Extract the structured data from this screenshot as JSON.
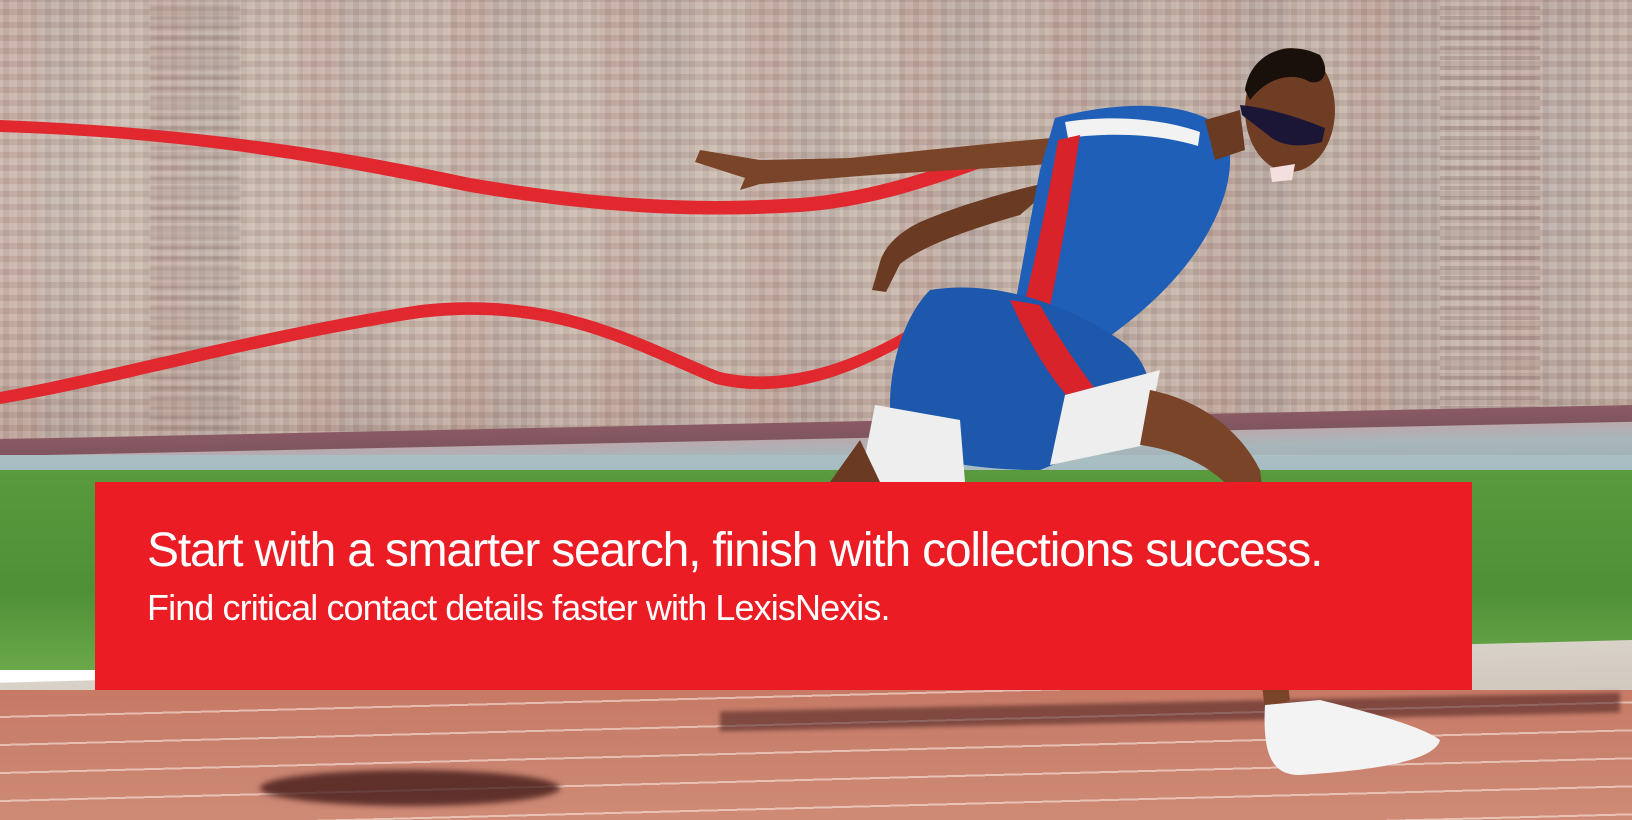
{
  "hero": {
    "image_description_icon": "sprinter-finish-line-photo"
  },
  "banner": {
    "headline": "Start with a smarter search, finish with collections success.",
    "subline": "Find critical contact details faster with LexisNexis.",
    "background_color": "#ec1c24",
    "text_color": "#ffffff"
  }
}
